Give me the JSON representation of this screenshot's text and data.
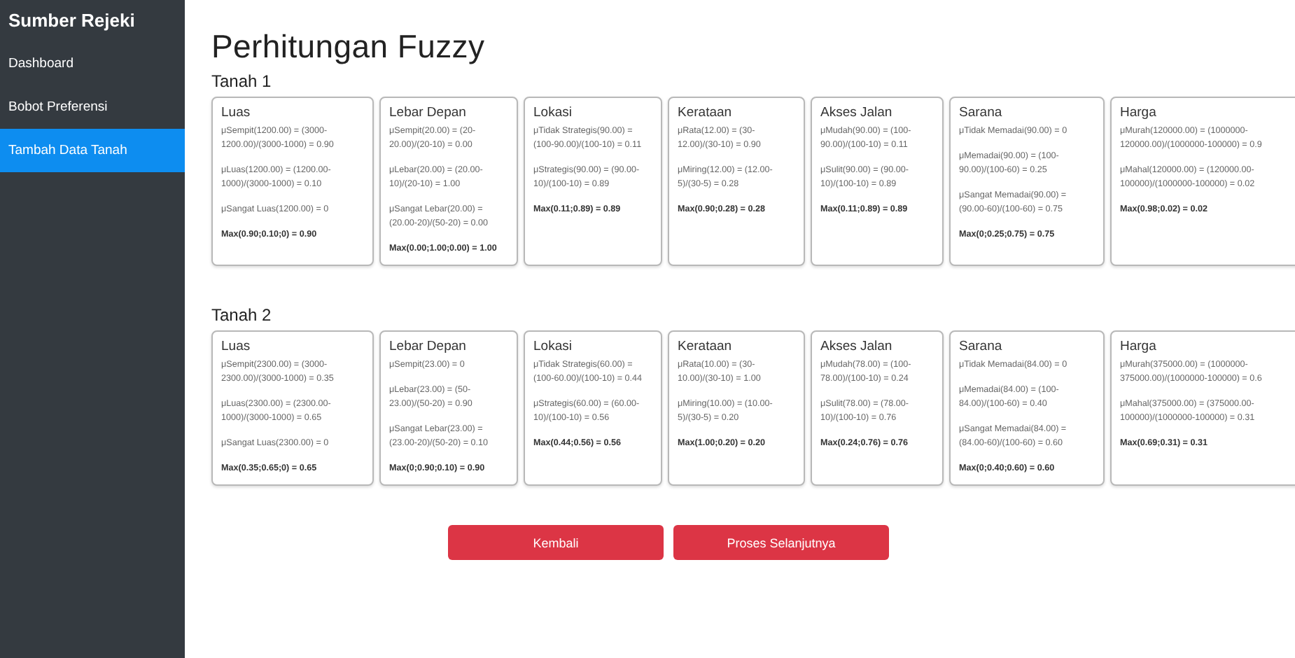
{
  "sidebar": {
    "brand": "Sumber Rejeki",
    "items": [
      {
        "label": "Dashboard",
        "selected": false
      },
      {
        "label": "Bobot Preferensi",
        "selected": false
      },
      {
        "label": "Tambah Data Tanah",
        "selected": true
      }
    ]
  },
  "page_title": "Perhitungan Fuzzy",
  "sections": [
    {
      "title": "Tanah 1",
      "cards": [
        {
          "title": "Luas",
          "lines": [
            "μSempit(1200.00) = (3000-1200.00)/(3000-1000) = 0.90",
            "μLuas(1200.00) = (1200.00-1000)/(3000-1000) = 0.10",
            "μSangat Luas(1200.00) = 0"
          ],
          "result": "Max(0.90;0.10;0) = 0.90"
        },
        {
          "title": "Lebar Depan",
          "lines": [
            "μSempit(20.00) = (20-20.00)/(20-10) = 0.00",
            "μLebar(20.00) = (20.00-10)/(20-10) = 1.00",
            "μSangat Lebar(20.00) = (20.00-20)/(50-20) = 0.00"
          ],
          "result": "Max(0.00;1.00;0.00) = 1.00"
        },
        {
          "title": "Lokasi",
          "lines": [
            "μTidak Strategis(90.00) = (100-90.00)/(100-10) = 0.11",
            "μStrategis(90.00) = (90.00-10)/(100-10) = 0.89"
          ],
          "result": "Max(0.11;0.89) = 0.89"
        },
        {
          "title": "Kerataan",
          "lines": [
            "μRata(12.00) = (30-12.00)/(30-10) = 0.90",
            "μMiring(12.00) = (12.00-5)/(30-5) = 0.28"
          ],
          "result": "Max(0.90;0.28) = 0.28"
        },
        {
          "title": "Akses Jalan",
          "lines": [
            "μMudah(90.00) = (100-90.00)/(100-10) = 0.11",
            "μSulit(90.00) = (90.00-10)/(100-10) = 0.89"
          ],
          "result": "Max(0.11;0.89) = 0.89"
        },
        {
          "title": "Sarana",
          "lines": [
            "μTidak Memadai(90.00) = 0",
            "μMemadai(90.00) = (100-90.00)/(100-60) = 0.25",
            "μSangat Memadai(90.00) = (90.00-60)/(100-60) = 0.75"
          ],
          "result": "Max(0;0.25;0.75) = 0.75"
        },
        {
          "title": "Harga",
          "lines": [
            "μMurah(120000.00) = (1000000-120000.00)/(1000000-100000) = 0.9",
            "μMahal(120000.00) = (120000.00-100000)/(1000000-100000) = 0.02"
          ],
          "result": "Max(0.98;0.02) = 0.02"
        }
      ]
    },
    {
      "title": "Tanah 2",
      "cards": [
        {
          "title": "Luas",
          "lines": [
            "μSempit(2300.00) = (3000-2300.00)/(3000-1000) = 0.35",
            "μLuas(2300.00) = (2300.00-1000)/(3000-1000) = 0.65",
            "μSangat Luas(2300.00) = 0"
          ],
          "result": "Max(0.35;0.65;0) = 0.65"
        },
        {
          "title": "Lebar Depan",
          "lines": [
            "μSempit(23.00) = 0",
            "μLebar(23.00) = (50-23.00)/(50-20) = 0.90",
            "μSangat Lebar(23.00) = (23.00-20)/(50-20) = 0.10"
          ],
          "result": "Max(0;0.90;0.10) = 0.90"
        },
        {
          "title": "Lokasi",
          "lines": [
            "μTidak Strategis(60.00) = (100-60.00)/(100-10) = 0.44",
            "μStrategis(60.00) = (60.00-10)/(100-10) = 0.56"
          ],
          "result": "Max(0.44;0.56) = 0.56"
        },
        {
          "title": "Kerataan",
          "lines": [
            "μRata(10.00) = (30-10.00)/(30-10) = 1.00",
            "μMiring(10.00) = (10.00-5)/(30-5) = 0.20"
          ],
          "result": "Max(1.00;0.20) = 0.20"
        },
        {
          "title": "Akses Jalan",
          "lines": [
            "μMudah(78.00) = (100-78.00)/(100-10) = 0.24",
            "μSulit(78.00) = (78.00-10)/(100-10) = 0.76"
          ],
          "result": "Max(0.24;0.76) = 0.76"
        },
        {
          "title": "Sarana",
          "lines": [
            "μTidak Memadai(84.00) = 0",
            "μMemadai(84.00) = (100-84.00)/(100-60) = 0.40",
            "μSangat Memadai(84.00) = (84.00-60)/(100-60) = 0.60"
          ],
          "result": "Max(0;0.40;0.60) = 0.60"
        },
        {
          "title": "Harga",
          "lines": [
            "μMurah(375000.00) = (1000000-375000.00)/(1000000-100000) = 0.6",
            "μMahal(375000.00) = (375000.00-100000)/(1000000-100000) = 0.31"
          ],
          "result": "Max(0.69;0.31) = 0.31"
        }
      ]
    }
  ],
  "buttons": [
    "Kembali",
    "Proses Selanjutnya"
  ]
}
